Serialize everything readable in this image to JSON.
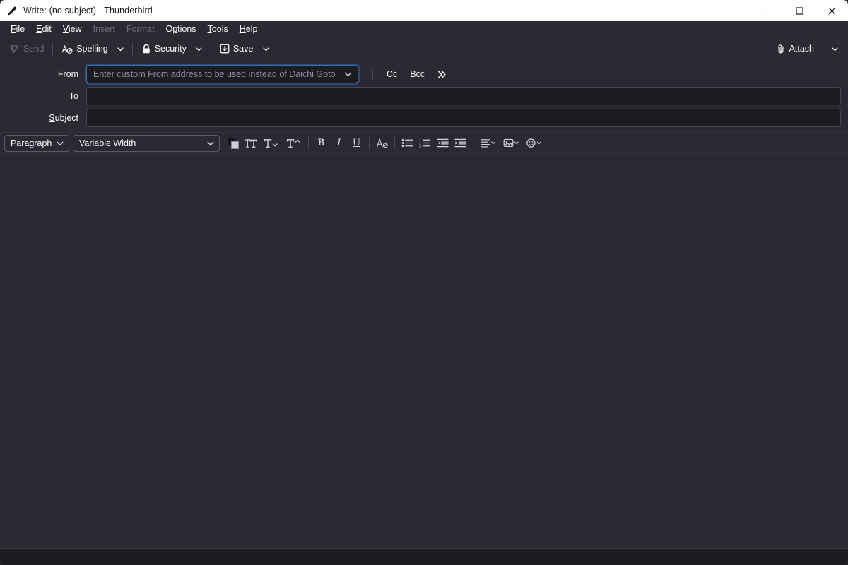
{
  "window": {
    "title": "Write: (no subject) - Thunderbird",
    "app_icon": "pencil-icon",
    "controls": {
      "minimize": "minimize-icon",
      "maximize": "maximize-icon",
      "close": "close-icon"
    }
  },
  "menubar": {
    "items": [
      {
        "label": "File",
        "accel": "F",
        "enabled": true
      },
      {
        "label": "Edit",
        "accel": "E",
        "enabled": true
      },
      {
        "label": "View",
        "accel": "V",
        "enabled": true
      },
      {
        "label": "Insert",
        "accel": "I",
        "enabled": false
      },
      {
        "label": "Format",
        "accel": "o",
        "enabled": false
      },
      {
        "label": "Options",
        "accel": "O",
        "enabled": true
      },
      {
        "label": "Tools",
        "accel": "T",
        "enabled": true
      },
      {
        "label": "Help",
        "accel": "H",
        "enabled": true
      }
    ]
  },
  "toolbar": {
    "send_label": "Send",
    "send_enabled": false,
    "spelling_label": "Spelling",
    "security_label": "Security",
    "save_label": "Save",
    "attach_label": "Attach"
  },
  "headers": {
    "from_label": "From",
    "from_placeholder": "Enter custom From address to be used instead of Daichi Goto",
    "from_value": "",
    "from_focused": true,
    "cc_label": "Cc",
    "bcc_label": "Bcc",
    "more_label": "more-recipients-icon",
    "to_label": "To",
    "to_value": "",
    "subject_label": "Subject",
    "subject_value": ""
  },
  "format_toolbar": {
    "paragraph_value": "Paragraph",
    "font_value": "Variable Width",
    "buttons": [
      {
        "name": "text-color-swatch",
        "title": "Text Color"
      },
      {
        "name": "font-size-icon",
        "title": "Font Size"
      },
      {
        "name": "decrease-size-icon",
        "title": "Decrease Font Size"
      },
      {
        "name": "increase-size-icon",
        "title": "Increase Font Size"
      },
      {
        "name": "bold-icon",
        "title": "Bold"
      },
      {
        "name": "italic-icon",
        "title": "Italic"
      },
      {
        "name": "underline-icon",
        "title": "Underline"
      },
      {
        "name": "remove-formatting-icon",
        "title": "Remove Text Styling"
      },
      {
        "name": "bulleted-list-icon",
        "title": "Bulleted List"
      },
      {
        "name": "numbered-list-icon",
        "title": "Numbered List"
      },
      {
        "name": "decrease-indent-icon",
        "title": "Decrease Indent"
      },
      {
        "name": "increase-indent-icon",
        "title": "Increase Indent"
      },
      {
        "name": "align-icon",
        "title": "Align"
      },
      {
        "name": "insert-image-icon",
        "title": "Insert"
      },
      {
        "name": "emoji-icon",
        "title": "Insert Smiley"
      }
    ]
  },
  "editor": {
    "content": ""
  },
  "statusbar": {
    "text": ""
  },
  "colors": {
    "titlebar_bg": "#ffffff",
    "chrome_bg": "#2b2a33",
    "field_bg": "#1c1b22",
    "text": "#fbfbfe",
    "text_disabled": "#6e6d78",
    "placeholder": "#8f8f9d",
    "focus_ring": "#3d6ea5",
    "border": "#46454f"
  }
}
